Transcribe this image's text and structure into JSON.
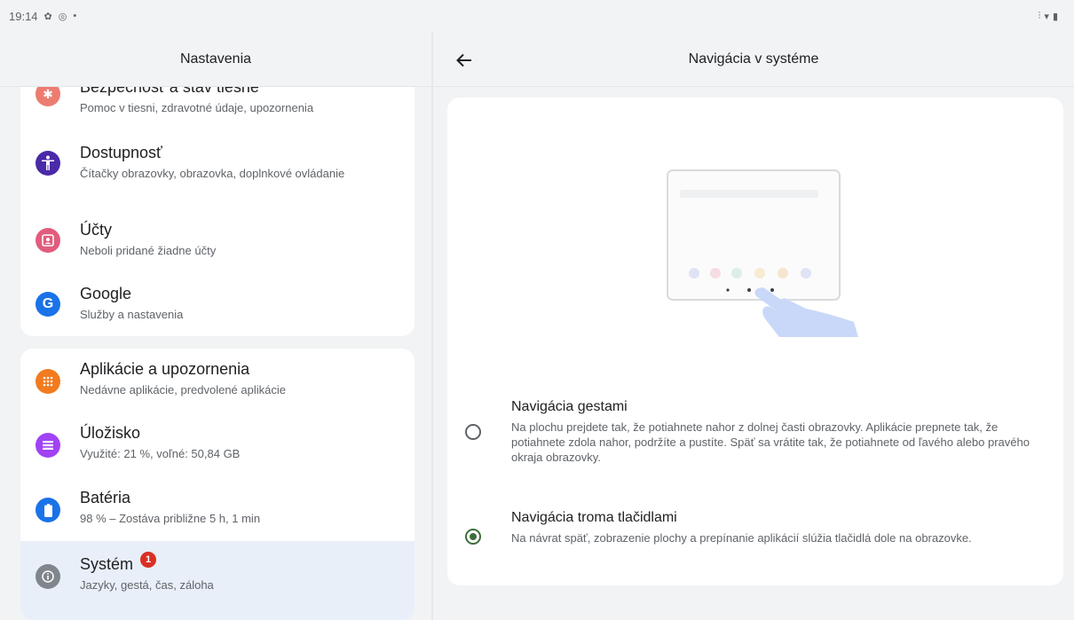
{
  "status_bar": {
    "time": "19:14",
    "left_icons": [
      "settings-gear-icon",
      "circle-dot-icon",
      "small-dot-icon"
    ],
    "right_icons": [
      "vibrate-icon",
      "wifi-icon",
      "battery-icon"
    ]
  },
  "left_pane": {
    "title": "Nastavenia",
    "card1_items": [
      {
        "title": "Bezpečnosť a stav tiesne",
        "subtitle": "Pomoc v tiesni, zdravotné údaje, upozornenia",
        "icon": "emergency-icon",
        "color": "#ec7c70"
      },
      {
        "title": "Dostupnosť",
        "subtitle": "Čítačky obrazovky, obrazovka, doplnkové ovládanie",
        "icon": "accessibility-icon",
        "color": "#4a2aa8"
      },
      {
        "title": "Účty",
        "subtitle": "Neboli pridané žiadne účty",
        "icon": "accounts-icon",
        "color": "#e25c7c"
      },
      {
        "title": "Google",
        "subtitle": "Služby a nastavenia",
        "icon": "google-icon",
        "color": "#1a73e8"
      }
    ],
    "card2_items": [
      {
        "title": "Aplikácie a upozornenia",
        "subtitle": "Nedávne aplikácie, predvolené aplikácie",
        "icon": "apps-icon",
        "color": "#f27b1f"
      },
      {
        "title": "Úložisko",
        "subtitle": "Využité: 21 %, voľné: 50,84 GB",
        "icon": "storage-icon",
        "color": "#a142f4"
      },
      {
        "title": "Batéria",
        "subtitle": "98 % – Zostáva približne 5 h, 1 min",
        "icon": "battery-icon",
        "color": "#1a73e8"
      },
      {
        "title": "Systém",
        "subtitle": "Jazyky, gestá, čas, záloha",
        "icon": "system-info-icon",
        "color": "#80868b",
        "badge": "1"
      }
    ]
  },
  "right_pane": {
    "title": "Navigácia v systéme",
    "options": [
      {
        "title": "Navigácia gestami",
        "description": "Na plochu prejdete tak, že potiahnete nahor z dolnej časti obrazovky. Aplikácie prepnete tak, že potiahnete zdola nahor, podržíte a pustíte. Späť sa vrátite tak, že potiahnete od ľavého alebo pravého okraja obrazovky.",
        "checked": false
      },
      {
        "title": "Navigácia troma tlačidlami",
        "description": "Na návrat späť, zobrazenie plochy a prepínanie aplikácií slúžia tlačidlá dole na obrazovke.",
        "checked": true
      }
    ]
  }
}
